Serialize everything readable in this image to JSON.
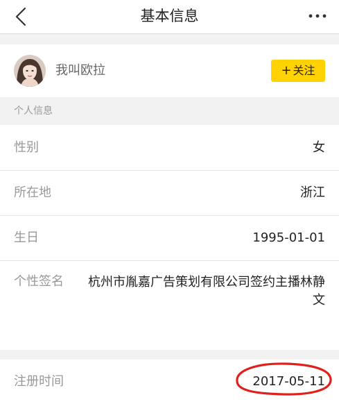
{
  "header": {
    "title": "基本信息",
    "back_icon": "chevron-left-icon",
    "more_icon": "more-horizontal-icon"
  },
  "profile": {
    "name": "我叫欧拉",
    "follow_label": "关注",
    "follow_color": "#ffd200"
  },
  "section": {
    "personal_info": "个人信息"
  },
  "info": {
    "gender": {
      "label": "性别",
      "value": "女"
    },
    "location": {
      "label": "所在地",
      "value": "浙江"
    },
    "birthday": {
      "label": "生日",
      "value": "1995-01-01"
    },
    "signature": {
      "label": "个性签名",
      "value": "杭州市胤嘉广告策划有限公司签约主播林静文"
    }
  },
  "registration": {
    "label": "注册时间",
    "value": "2017-05-11",
    "highlight_color": "#e0201c"
  }
}
